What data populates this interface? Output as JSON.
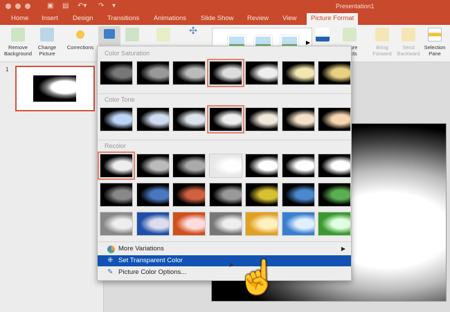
{
  "window": {
    "title": "Presentation1"
  },
  "tabs": [
    "Home",
    "Insert",
    "Design",
    "Transitions",
    "Animations",
    "Slide Show",
    "Review",
    "View",
    "Picture Format"
  ],
  "ribbon": {
    "remove_bg": "Remove Background",
    "change_picture": "Change Picture",
    "corrections": "Corrections",
    "partial_effects": "ure\ncts",
    "bring_forward": "Bring Forward",
    "send_backward": "Send Backward",
    "selection_pane": "Selection Pane"
  },
  "slides": {
    "number": "1"
  },
  "dropdown": {
    "color_saturation": "Color Saturation",
    "color_tone": "Color Tone",
    "recolor": "Recolor",
    "saturation_tiles": [
      {
        "bg": "#000",
        "fg": "#777"
      },
      {
        "bg": "#000",
        "fg": "#999"
      },
      {
        "bg": "#000",
        "fg": "#bbb"
      },
      {
        "bg": "#000",
        "fg": "#ddd",
        "sel": true
      },
      {
        "bg": "#000",
        "fg": "#eee"
      },
      {
        "bg": "#000",
        "fg": "#f3e6b0"
      },
      {
        "bg": "#000",
        "fg": "#e8d080"
      }
    ],
    "tone_tiles": [
      {
        "bg": "#000",
        "fg": "#bcd4f5"
      },
      {
        "bg": "#000",
        "fg": "#cfdcf0"
      },
      {
        "bg": "#000",
        "fg": "#dde3ea"
      },
      {
        "bg": "#000",
        "fg": "#eee",
        "sel": true
      },
      {
        "bg": "#000",
        "fg": "#f1e8dc"
      },
      {
        "bg": "#000",
        "fg": "#f5e0c8"
      },
      {
        "bg": "#000",
        "fg": "#f5d6b0"
      }
    ],
    "recolor_tiles": [
      {
        "bg": "#000",
        "fg": "#eee",
        "sel": true
      },
      {
        "bg": "#000",
        "fg": "#bbb"
      },
      {
        "bg": "#000",
        "fg": "#aaa"
      },
      {
        "bg": "#e8e8e8",
        "fg": "#fff"
      },
      {
        "bg": "#000",
        "fg": "#fff"
      },
      {
        "bg": "#000",
        "fg": "#fff"
      },
      {
        "bg": "#000",
        "fg": "#fff"
      },
      {
        "bg": "#000",
        "fg": "#888"
      },
      {
        "bg": "#000",
        "fg": "#4a78c0"
      },
      {
        "bg": "#000",
        "fg": "#d06040"
      },
      {
        "bg": "#000",
        "fg": "#999"
      },
      {
        "bg": "#000",
        "fg": "#d8c030"
      },
      {
        "bg": "#000",
        "fg": "#4a88d0"
      },
      {
        "bg": "#000",
        "fg": "#5ab050"
      },
      {
        "bg": "#888",
        "fg": "#eee"
      },
      {
        "bg": "#1f4fa8",
        "fg": "#dde"
      },
      {
        "bg": "#d0501c",
        "fg": "#fdd"
      },
      {
        "bg": "#777",
        "fg": "#eee"
      },
      {
        "bg": "#e0a020",
        "fg": "#fff0c0"
      },
      {
        "bg": "#3a7ed0",
        "fg": "#e0f0ff"
      },
      {
        "bg": "#3a9a30",
        "fg": "#e0ffe0"
      }
    ],
    "more_variations": "More Variations",
    "set_transparent": "Set Transparent Color",
    "color_options": "Picture Color Options..."
  },
  "colors": {
    "accent": "#c8492b",
    "highlight": "#1152b3"
  }
}
